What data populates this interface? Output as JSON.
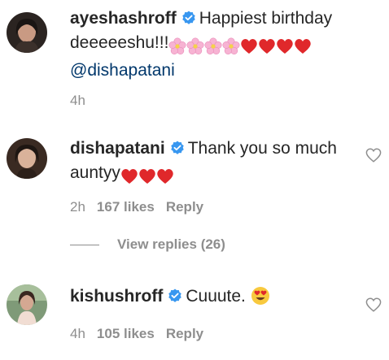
{
  "comments": [
    {
      "username": "ayeshashroff",
      "text": "Happiest birthday deeeeeshu!!!",
      "mention": "@dishapatani",
      "time": "4h"
    },
    {
      "username": "dishapatani",
      "text": "Thank you so much auntyy",
      "time": "2h",
      "likes": "167 likes",
      "reply_label": "Reply"
    },
    {
      "username": "kishushroff",
      "text": "Cuuute.",
      "time": "4h",
      "likes": "105 likes",
      "reply_label": "Reply"
    }
  ],
  "view_replies": "View replies (26)",
  "icons": {
    "verified": "verified-badge-icon",
    "like": "heart-outline-icon",
    "flower": "cherry-blossom-emoji",
    "heart": "red-heart-emoji",
    "heart_eyes": "heart-eyes-emoji"
  },
  "colors": {
    "text": "#262626",
    "secondary": "#8e8e8e",
    "verified_blue": "#3897f0",
    "mention": "#00376b",
    "heart_red": "#e0282b",
    "flower_pink": "#f7b3d3"
  }
}
